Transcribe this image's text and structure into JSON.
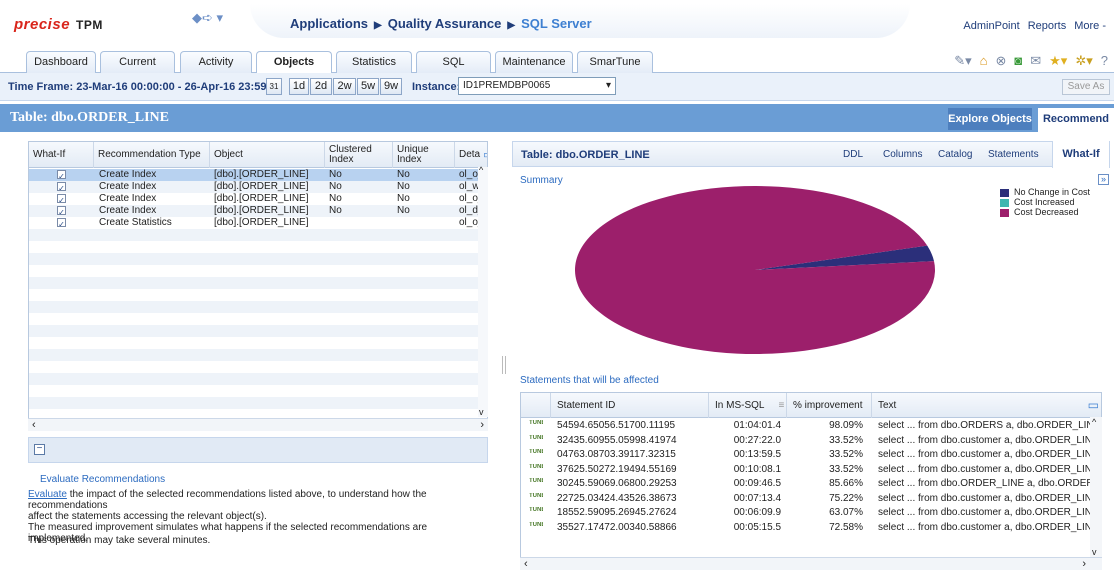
{
  "header": {
    "logo": "precise",
    "product": "TPM",
    "breadcrumbs": [
      "Applications",
      "Quality Assurance",
      "SQL Server"
    ],
    "top_links": [
      "AdminPoint",
      "Reports",
      "More -"
    ]
  },
  "tabs": [
    "Dashboard",
    "Current",
    "Activity",
    "Objects",
    "Statistics",
    "SQL",
    "Maintenance",
    "SmarTune"
  ],
  "active_tab": "Objects",
  "timeframe": {
    "label": "Time Frame:",
    "value": "23-Mar-16 00:00:00 - 26-Apr-16 23:59:59",
    "calendar": "31",
    "ranges": [
      "1d",
      "2d",
      "2w",
      "5w",
      "9w"
    ],
    "instance_label": "Instance:",
    "instance_value": "ID1PREMDBP0065",
    "save_as": "Save As"
  },
  "title_bar": {
    "title": "Table: dbo.ORDER_LINE",
    "explore": "Explore Objects",
    "recommend": "Recommend"
  },
  "left_grid": {
    "columns": [
      "What-If",
      "Recommendation Type",
      "Object",
      "Clustered Index",
      "Unique Index",
      "Deta"
    ],
    "rows": [
      {
        "type": "Create Index",
        "object": "[dbo].[ORDER_LINE]",
        "clustered": "No",
        "unique": "No",
        "detail": "ol_o_"
      },
      {
        "type": "Create Index",
        "object": "[dbo].[ORDER_LINE]",
        "clustered": "No",
        "unique": "No",
        "detail": "ol_w"
      },
      {
        "type": "Create Index",
        "object": "[dbo].[ORDER_LINE]",
        "clustered": "No",
        "unique": "No",
        "detail": "ol_o_"
      },
      {
        "type": "Create Index",
        "object": "[dbo].[ORDER_LINE]",
        "clustered": "No",
        "unique": "No",
        "detail": "ol_d_"
      },
      {
        "type": "Create Statistics",
        "object": "[dbo].[ORDER_LINE]",
        "clustered": "",
        "unique": "",
        "detail": "ol_o_"
      }
    ]
  },
  "evaluate": {
    "heading": "Evaluate Recommendations",
    "link": "Evaluate",
    "line1": " the impact of the selected recommendations listed above, to understand how the recommendations",
    "line2": "affect the statements accessing the relevant object(s).",
    "line3": "The measured improvement simulates what happens if the selected recommendations are implemented.",
    "note": "This operation may take several minutes."
  },
  "right_panel": {
    "title": "Table: dbo.ORDER_LINE",
    "tabs": [
      "DDL",
      "Columns",
      "Catalog",
      "Statements",
      "What-If"
    ],
    "summary": "Summary",
    "affected": "Statements that will be affected"
  },
  "chart_data": {
    "type": "pie",
    "series": [
      {
        "name": "No Change in Cost",
        "value": 3,
        "color": "#2b2f7a"
      },
      {
        "name": "Cost Increased",
        "value": 0,
        "color": "#3fb6b0"
      },
      {
        "name": "Cost Decreased",
        "value": 97,
        "color": "#9c1f6b"
      }
    ]
  },
  "right_grid": {
    "columns": [
      "Statement ID",
      "In MS-SQL",
      "% improvement",
      "Text"
    ],
    "icon_label": "TUNE",
    "rows": [
      {
        "id": "54594.65056.51700.11195",
        "ms": "01:04:01.4",
        "pct": "98.09%",
        "text": "select ... from dbo.ORDERS a, dbo.ORDER_LINE ..."
      },
      {
        "id": "32435.60955.05998.41974",
        "ms": "00:27:22.0",
        "pct": "33.52%",
        "text": "select ... from dbo.customer a, dbo.ORDER_LINE ..."
      },
      {
        "id": "04763.08703.39117.32315",
        "ms": "00:13:59.5",
        "pct": "33.52%",
        "text": "select ... from dbo.customer a, dbo.ORDER_LINE ..."
      },
      {
        "id": "37625.50272.19494.55169",
        "ms": "00:10:08.1",
        "pct": "33.52%",
        "text": "select ... from dbo.customer a, dbo.ORDER_LINE ..."
      },
      {
        "id": "30245.59069.06800.29253",
        "ms": "00:09:46.5",
        "pct": "85.66%",
        "text": "select ... from dbo.ORDER_LINE a, dbo.ORDER_L..."
      },
      {
        "id": "22725.03424.43526.38673",
        "ms": "00:07:13.4",
        "pct": "75.22%",
        "text": "select ... from dbo.customer a, dbo.ORDER_LINE ..."
      },
      {
        "id": "18552.59095.26945.27624",
        "ms": "00:06:09.9",
        "pct": "63.07%",
        "text": "select ... from dbo.customer a, dbo.ORDER_LINE ..."
      },
      {
        "id": "35527.17472.00340.58866",
        "ms": "00:05:15.5",
        "pct": "72.58%",
        "text": "select ... from dbo.customer a, dbo.ORDER_LINE ..."
      }
    ]
  }
}
